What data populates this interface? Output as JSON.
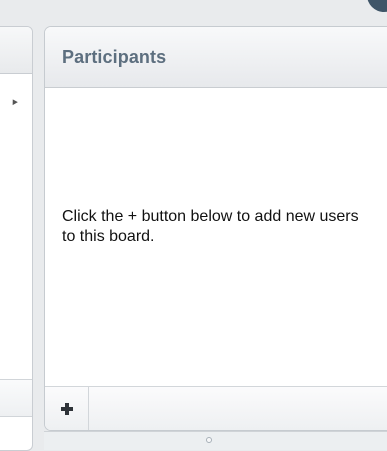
{
  "participants": {
    "title": "Participants",
    "empty_message": "Click the + button below to add new users to this board."
  },
  "footer": {
    "add_icon": "plus-icon"
  },
  "colors": {
    "title": "#5d6f7f",
    "text": "#111111",
    "panel_border": "#c6cbd0",
    "background": "#e9ebed"
  }
}
